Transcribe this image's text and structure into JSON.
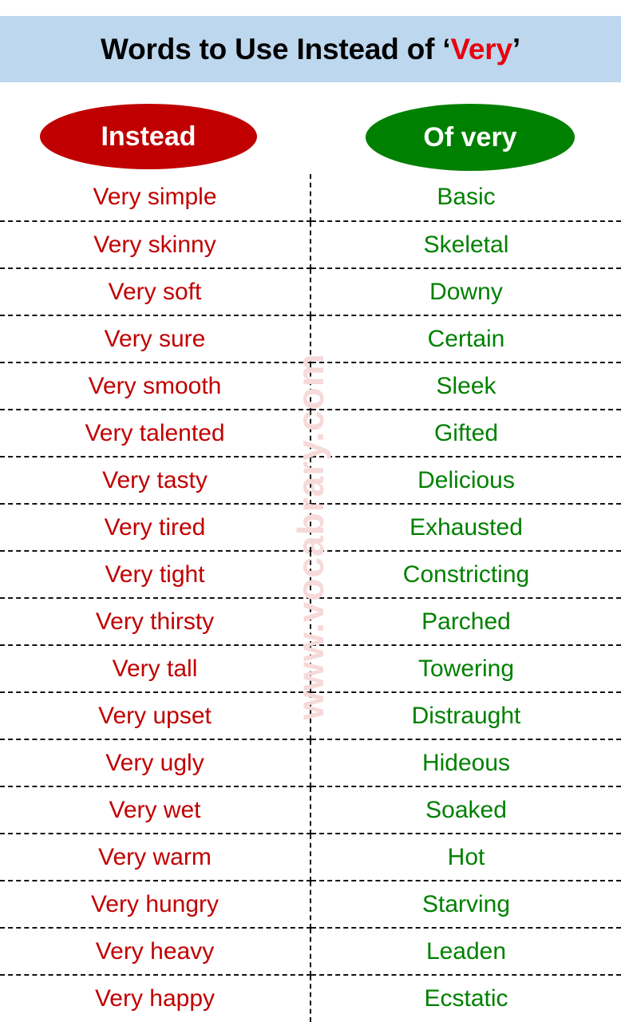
{
  "header": {
    "title_prefix": "Words to Use Instead of ",
    "open_quote": "‘",
    "title_accent": "Very",
    "close_quote": "’",
    "background_color": "#bdd7ee",
    "accent_color": "#e8000d"
  },
  "columns": {
    "left": {
      "label": "Instead",
      "pill_color": "#c00000",
      "text_color": "#c00000"
    },
    "right": {
      "label": "Of very",
      "pill_color": "#008000",
      "text_color": "#008000"
    }
  },
  "watermark": {
    "text": "www.vocabrary.com",
    "color": "#f6d9d9"
  },
  "rows": [
    {
      "instead": "Very simple",
      "of_very": "Basic"
    },
    {
      "instead": "Very skinny",
      "of_very": "Skeletal"
    },
    {
      "instead": "Very soft",
      "of_very": "Downy"
    },
    {
      "instead": "Very sure",
      "of_very": "Certain"
    },
    {
      "instead": "Very smooth",
      "of_very": "Sleek"
    },
    {
      "instead": "Very talented",
      "of_very": "Gifted"
    },
    {
      "instead": "Very tasty",
      "of_very": "Delicious"
    },
    {
      "instead": "Very tired",
      "of_very": "Exhausted"
    },
    {
      "instead": "Very tight",
      "of_very": "Constricting"
    },
    {
      "instead": "Very thirsty",
      "of_very": "Parched"
    },
    {
      "instead": "Very tall",
      "of_very": "Towering"
    },
    {
      "instead": "Very upset",
      "of_very": "Distraught"
    },
    {
      "instead": "Very ugly",
      "of_very": "Hideous"
    },
    {
      "instead": "Very wet",
      "of_very": "Soaked"
    },
    {
      "instead": "Very warm",
      "of_very": "Hot"
    },
    {
      "instead": "Very hungry",
      "of_very": "Starving"
    },
    {
      "instead": "Very heavy",
      "of_very": "Leaden"
    },
    {
      "instead": "Very happy",
      "of_very": "Ecstatic"
    }
  ]
}
